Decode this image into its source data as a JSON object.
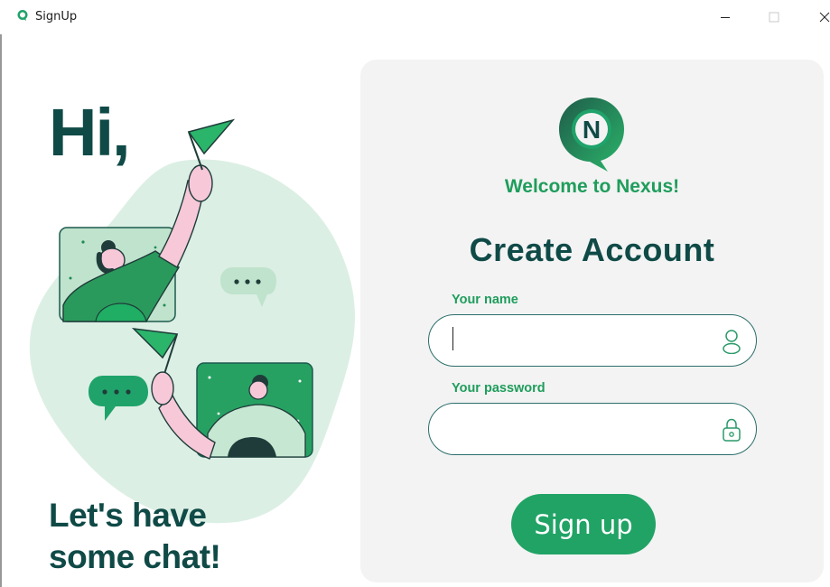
{
  "window": {
    "title": "SignUp",
    "app_icon": "nexus-chat-icon",
    "controls": [
      "minimize-icon",
      "maximize-icon",
      "close-icon"
    ]
  },
  "left": {
    "greeting": "Hi,",
    "tagline_line1": "Let's have",
    "tagline_line2": "some chat!"
  },
  "card": {
    "logo_letter": "N",
    "welcome": "Welcome to Nexus!",
    "heading": "Create Account",
    "name_field": {
      "label": "Your name",
      "value": "",
      "placeholder": "",
      "icon": "user-icon"
    },
    "password_field": {
      "label": "Your password",
      "value": "",
      "placeholder": "",
      "icon": "lock-icon"
    },
    "signup_label": "Sign up"
  },
  "colors": {
    "dark_teal": "#0f4a47",
    "brand_green": "#1f9d5c",
    "button_green": "#21a365",
    "card_bg": "#f3f3f3",
    "blob": "#dcefe4"
  }
}
